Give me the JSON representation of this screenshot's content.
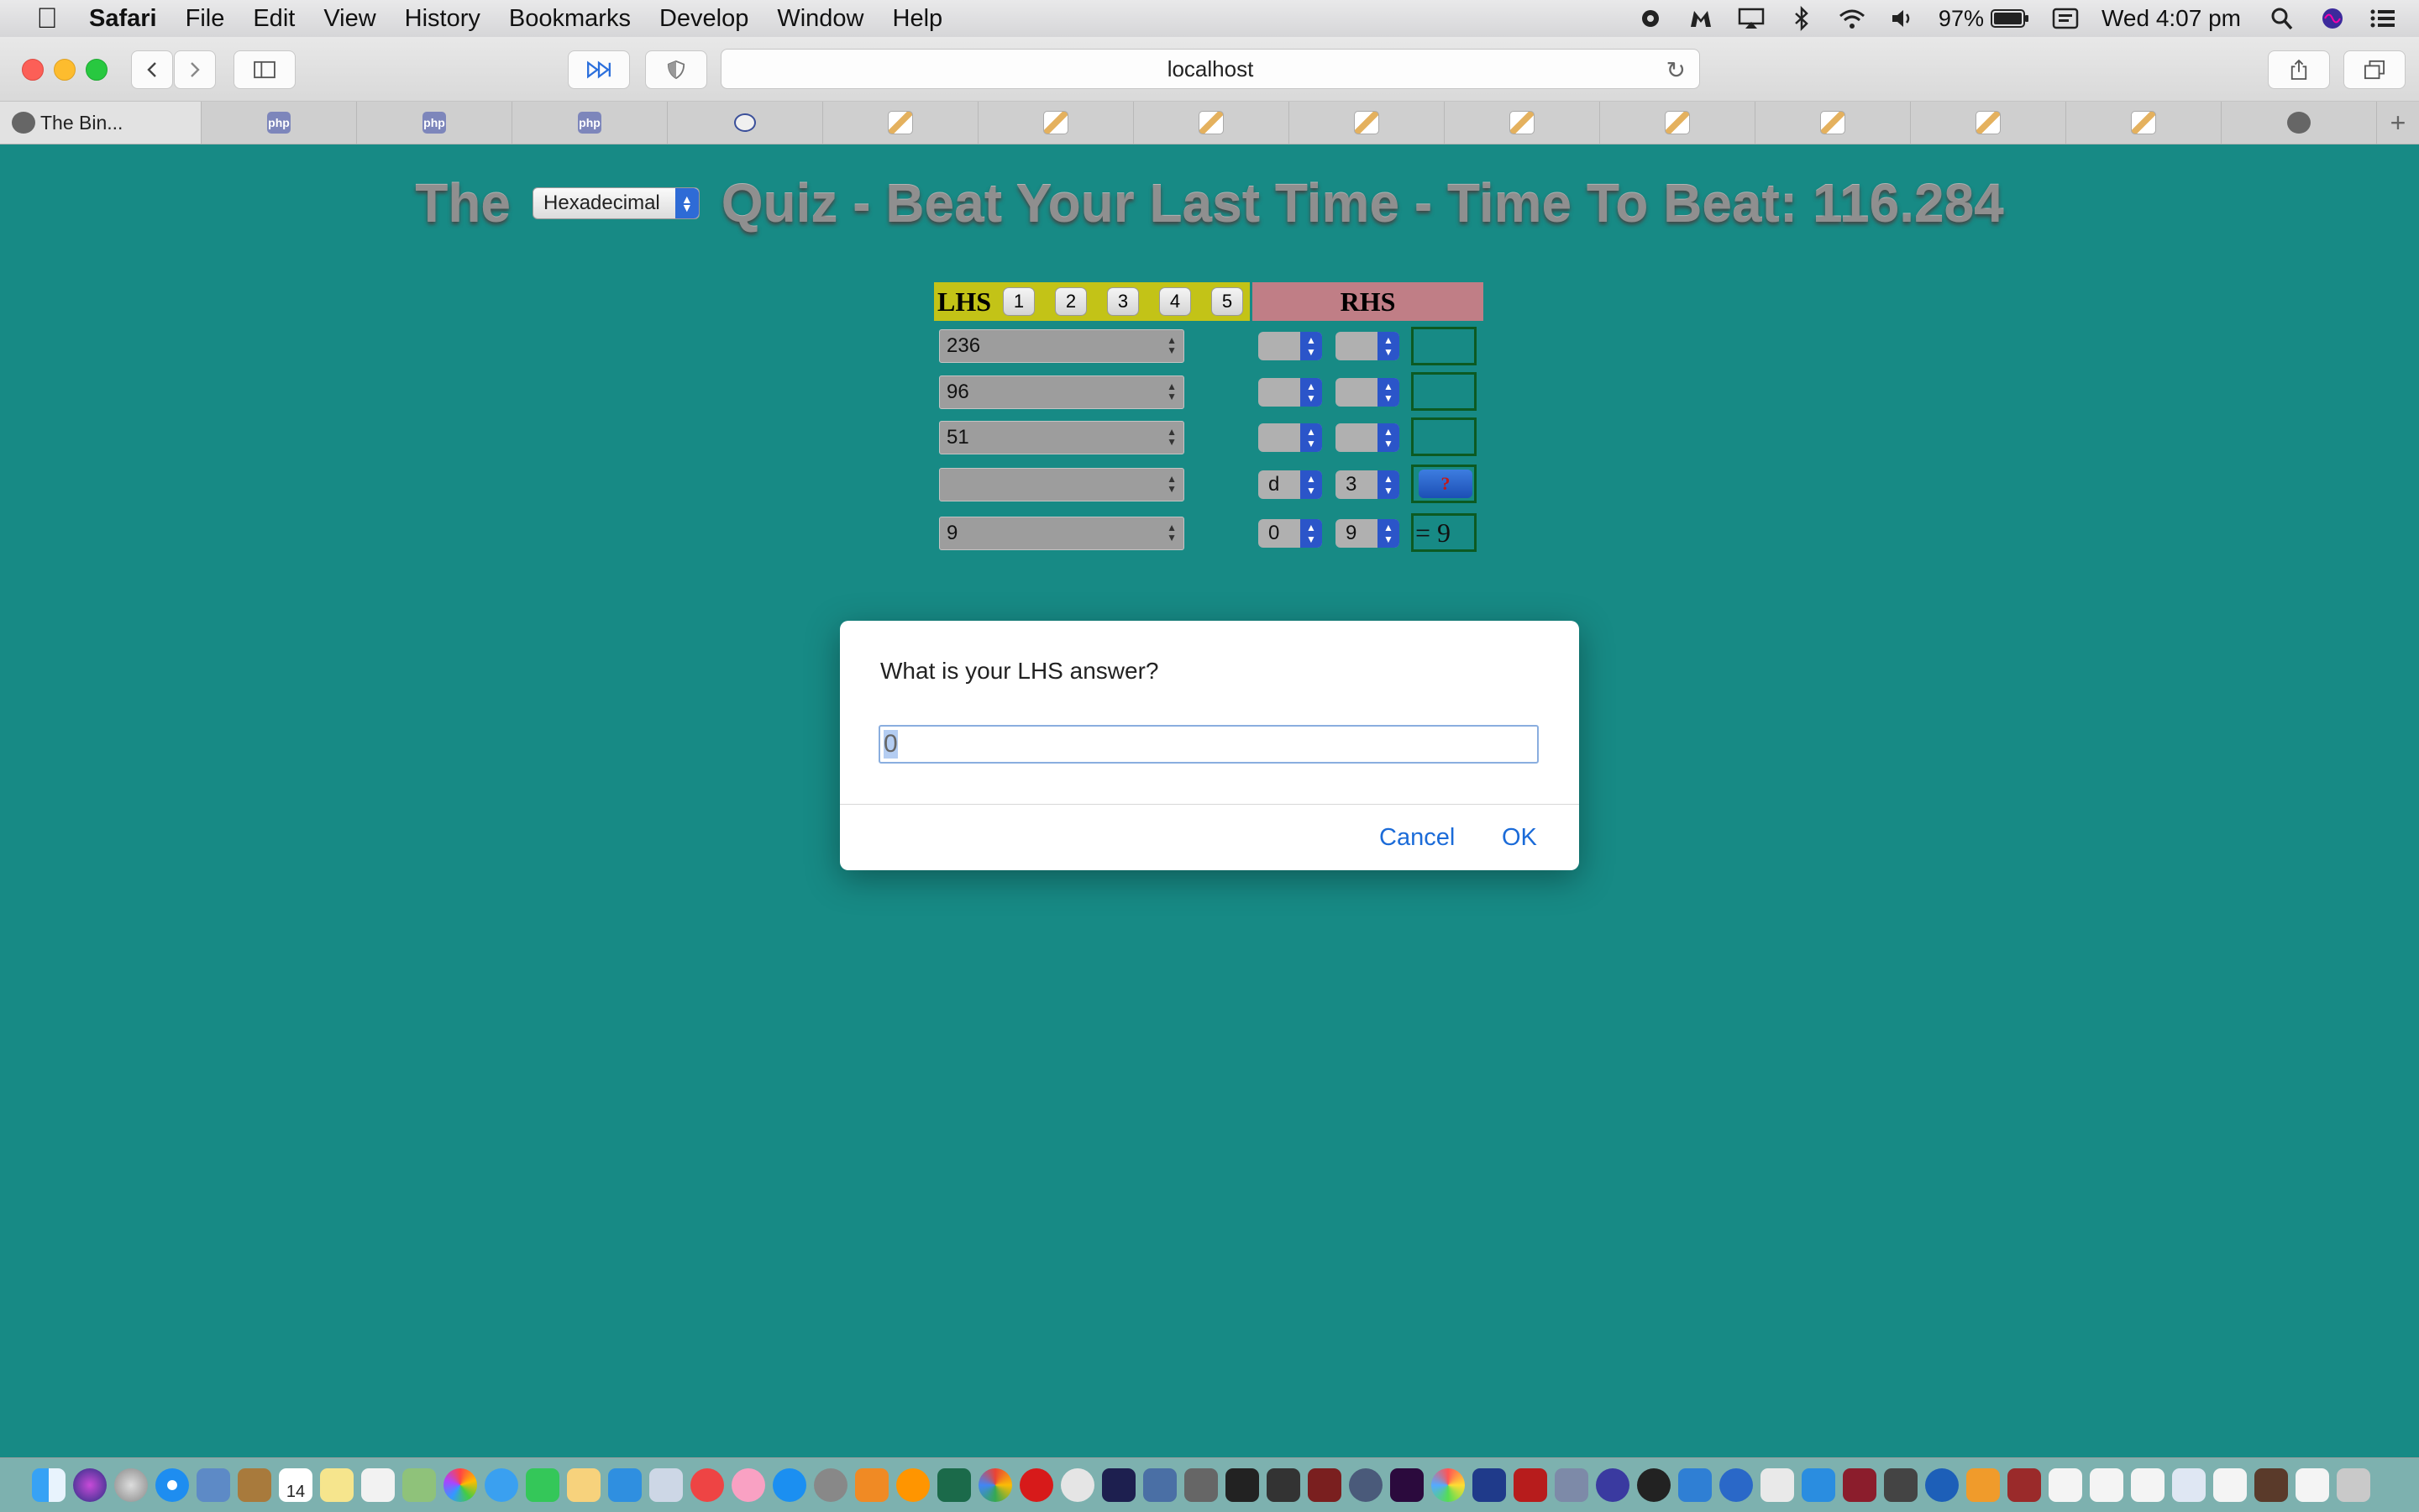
{
  "menubar": {
    "app": "Safari",
    "items": [
      "File",
      "Edit",
      "View",
      "History",
      "Bookmarks",
      "Develop",
      "Window",
      "Help"
    ],
    "battery": "97%",
    "clock": "Wed 4:07 pm"
  },
  "browser": {
    "url": "localhost",
    "tabs": [
      {
        "title": "The Bin...",
        "icon": "ghost-icon"
      },
      {
        "title": "",
        "icon": "php-icon"
      },
      {
        "title": "",
        "icon": "php-icon"
      },
      {
        "title": "",
        "icon": "php-icon"
      },
      {
        "title": "",
        "icon": "afl-icon"
      },
      {
        "title": "",
        "icon": "pen-icon"
      },
      {
        "title": "",
        "icon": "pen-icon"
      },
      {
        "title": "",
        "icon": "pen-icon"
      },
      {
        "title": "",
        "icon": "pen-icon"
      },
      {
        "title": "",
        "icon": "pen-icon"
      },
      {
        "title": "",
        "icon": "pen-icon"
      },
      {
        "title": "",
        "icon": "pen-icon"
      },
      {
        "title": "",
        "icon": "pen-icon"
      },
      {
        "title": "",
        "icon": "pen-icon"
      },
      {
        "title": "",
        "icon": "ghost-icon"
      }
    ],
    "favicon_text": {
      "php": "php",
      "afl": "AFL"
    }
  },
  "page": {
    "title_pre": "The",
    "base_select": "Hexadecimal",
    "title_post": "Quiz - Beat Your Last Time - Time To Beat: 116.284",
    "lhs_label": "LHS",
    "lhs_buttons": [
      "1",
      "2",
      "3",
      "4",
      "5"
    ],
    "rhs_label": "RHS",
    "rows": [
      {
        "lhs": "236",
        "sel1": "",
        "sel2": "",
        "answer": ""
      },
      {
        "lhs": "96",
        "sel1": "",
        "sel2": "",
        "answer": ""
      },
      {
        "lhs": "51",
        "sel1": "",
        "sel2": "",
        "answer": ""
      },
      {
        "lhs": "",
        "sel1": "d",
        "sel2": "3",
        "answer": "?"
      },
      {
        "lhs": "9",
        "sel1": "0",
        "sel2": "9",
        "answer": "= 9"
      }
    ]
  },
  "dialog": {
    "message": "What is your LHS answer?",
    "value": "0",
    "cancel": "Cancel",
    "ok": "OK"
  },
  "dock": {
    "calendar_day": "14"
  },
  "colors": {
    "page_bg": "#178a85",
    "lhs_header": "#c3c317",
    "rhs_header": "#c07e86",
    "accent_link": "#1b6bd8"
  }
}
